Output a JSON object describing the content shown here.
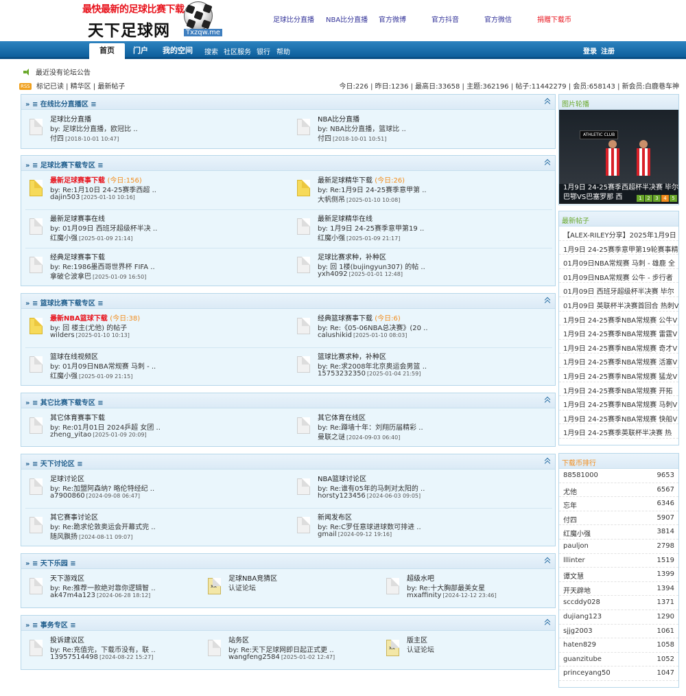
{
  "site": {
    "slogan": "最快最新的足球比赛下载",
    "name": "天下足球网",
    "url": "Txzqw.me"
  },
  "top_links": [
    "足球比分直播",
    "NBA比分直播",
    "官方微博",
    "官方抖音",
    "官方微信",
    "捐赠下载币"
  ],
  "nav": {
    "tabs": [
      "首页",
      "门户",
      "我的空间"
    ],
    "subs": [
      "搜索",
      "社区服务",
      "银行",
      "帮助"
    ],
    "login": "登录",
    "register": "注册"
  },
  "notice": "最近没有论坛公告",
  "quick_links": {
    "rss": "RSS",
    "text": "标记已读 | 精华区 | 最新帖子"
  },
  "stats": "今日:226 | 昨日:1236 | 最高日:33658 | 主题:362196 | 帖子:11442279 | 会员:658143 | 新会员:白鹿巷车神",
  "sections": [
    {
      "title": "» ≡ 在线比分直播区 ≡",
      "forums": [
        {
          "name": "足球比分直播",
          "by": "by: 足球比分直播，欧冠比 ..",
          "author": "付四",
          "date": "[2018-10-01 10:47]"
        },
        {
          "name": "NBA比分直播",
          "by": "by: NBA比分直播，篮球比 ..",
          "author": "付四",
          "date": "[2018-10-01 10:51]"
        }
      ]
    },
    {
      "title": "» ≡ 足球比赛下载专区 ≡",
      "forums": [
        {
          "name": "最新足球赛事下载",
          "today": "(今日:156)",
          "by": "by: Re:1月10日 24-25赛季西超 ..",
          "author": "dajin503",
          "date": "[2025-01-10 10:16]"
        },
        {
          "name": "最新足球精华下载",
          "today": "(今日:26)",
          "by": "by: Re:1月9日 24-25赛季意甲第 ..",
          "author": "大帆侧吊",
          "date": "[2025-01-10 10:08]"
        },
        {
          "name": "最新足球赛事在线",
          "by": "by: 01月09日 西班牙超级杯半决 ..",
          "author": "红魔小强",
          "date": "[2025-01-09 21:14]"
        },
        {
          "name": "最新足球精华在线",
          "by": "by: 1月9日 24-25赛季意甲第19 ..",
          "author": "红魔小强",
          "date": "[2025-01-09 21:17]"
        },
        {
          "name": "经典足球赛事下载",
          "by": "by: Re:1986墨西哥世界杯 FIFA ..",
          "author": "拿破仑波拿巴",
          "date": "[2025-01-09 16:50]"
        },
        {
          "name": "足球比赛求种，补种区",
          "by": "by: 回 1楼(bujingyun307) 的帖 ..",
          "author": "yxh4092",
          "date": "[2025-01-01 12:48]"
        }
      ]
    },
    {
      "title": "» ≡ 篮球比赛下载专区 ≡",
      "forums": [
        {
          "name": "最新NBA篮球下载",
          "today": "(今日:38)",
          "by": "by: 回 楼主(尤他) 的帖子",
          "author": "wilders",
          "date": "[2025-01-10 10:13]"
        },
        {
          "name": "经典篮球赛事下载",
          "today": "(今日:6)",
          "by": "by: Re:《05-06NBA总决赛》(20 ..",
          "author": "calushikid",
          "date": "[2025-01-10 08:03]"
        },
        {
          "name": "篮球在线视频区",
          "by": "by: 01月09日NBA常规赛 马刺 - ..",
          "author": "红魔小强",
          "date": "[2025-01-09 21:15]"
        },
        {
          "name": "篮球比赛求种，补种区",
          "by": "by: Re:求2008年北京奥运会男篮 ..",
          "author": "15753232350",
          "date": "[2025-01-04 21:59]"
        }
      ]
    },
    {
      "title": "» ≡ 其它比赛下载专区 ≡",
      "forums": [
        {
          "name": "其它体育赛事下载",
          "by": "by: Re:01月01日 2024乒超 女团 ..",
          "author": "zheng_yitao",
          "date": "[2025-01-09 20:09]"
        },
        {
          "name": "其它体育在线区",
          "by": "by: Re:蹲墙十年：刘翔历届精彩 ..",
          "author": "曼联之谜",
          "date": "[2024-09-03 06:40]"
        }
      ]
    },
    {
      "title": "» ≡ 天下讨论区 ≡",
      "forums": [
        {
          "name": "足球讨论区",
          "by": "by: Re:加盟阿森纳? 略伦特经纪 ..",
          "author": "a7900860",
          "date": "[2024-09-08 06:47]"
        },
        {
          "name": "NBA篮球讨论区",
          "by": "by: Re:谁有05年的马刺对太阳的 ..",
          "author": "horsty123456",
          "date": "[2024-06-03 09:05]"
        },
        {
          "name": "其它赛事讨论区",
          "by": "by: Re:跪求伦敦奥运会开幕式完 ..",
          "author": "随风飘扬",
          "date": "[2024-08-11 09:07]"
        },
        {
          "name": "新闻发布区",
          "by": "by: Re:C罗任意球进球数可排进 ..",
          "author": "gmail",
          "date": "[2024-09-12 19:16]"
        }
      ]
    },
    {
      "title": "» ≡ 天下乐园 ≡",
      "forums": [
        {
          "name": "天下游戏区",
          "by": "by: Re:推荐一款绝对靠你逻辑智 ..",
          "author": "ak47m4a123",
          "date": "[2024-06-28 18:12]"
        },
        {
          "name": "足球NBA竞猜区",
          "by": "认证论坛"
        },
        {
          "name": "超级水吧",
          "by": "by: Re:十大胸部最美女星",
          "author": "mxaffinity",
          "date": "[2024-12-12 23:46]"
        }
      ]
    },
    {
      "title": "» ≡ 事务专区 ≡",
      "forums": [
        {
          "name": "投诉建议区",
          "by": "by: Re:充值完，下载币没有，联 ..",
          "author": "13957514498",
          "date": "[2024-08-22 15:27]"
        },
        {
          "name": "站务区",
          "by": "by: Re:天下足球网即日起正式更 ..",
          "author": "wangfeng2584",
          "date": "[2025-01-02 12:47]"
        },
        {
          "name": "版主区",
          "by": "认证论坛"
        }
      ]
    }
  ],
  "sidebar": {
    "carousel": {
      "title": "图片轮播",
      "club": "ATHLETIC CLUB",
      "caption1": "1月9日 24-25赛季西超杯半决赛 毕尔",
      "caption2": "巴鄂VS巴塞罗那 西",
      "dots": [
        "1",
        "2",
        "3",
        "4",
        "5"
      ]
    },
    "latest": {
      "title": "最新帖子",
      "items": [
        "【ALEX-RILEY分享】2025年1月9日",
        "1月9日 24-25赛季意甲第19轮赛事精",
        "01月09日NBA常规赛 马刺 - 雄鹿 全",
        "01月09日NBA常规赛 公牛 - 步行者",
        "01月09日 西班牙超级杯半决赛 毕尔",
        "01月09日 英联杯半决赛首回合 热刺V",
        "1月9日 24-25赛季NBA常规赛 公牛V",
        "1月9日 24-25赛季NBA常规赛 雷霆V",
        "1月9日 24-25赛季NBA常规赛 奇才V",
        "1月9日 24-25赛季NBA常规赛 活塞V",
        "1月9日 24-25赛季NBA常规赛 猛龙V",
        "1月9日 24-25赛季NBA常规赛 开拓",
        "1月9日 24-25赛季NBA常规赛 马刺V",
        "1月9日 24-25赛季NBA常规赛 快船V",
        "1月9日 24-25赛季英联杯半决赛 热"
      ]
    },
    "ranking": {
      "title": "下载币排行",
      "items": [
        {
          "name": "88581000",
          "n": "9653"
        },
        {
          "name": "尤他",
          "n": "6567"
        },
        {
          "name": "忘年",
          "n": "6346"
        },
        {
          "name": "付四",
          "n": "5907"
        },
        {
          "name": "红魔小强",
          "n": "3814"
        },
        {
          "name": "pauljon",
          "n": "2798"
        },
        {
          "name": "lllinter",
          "n": "1519"
        },
        {
          "name": "谭文慧",
          "n": "1399"
        },
        {
          "name": "开天辟地",
          "n": "1394"
        },
        {
          "name": "sccddy028",
          "n": "1371"
        },
        {
          "name": "dujiang123",
          "n": "1290"
        },
        {
          "name": "sjjg2003",
          "n": "1061"
        },
        {
          "name": "haten829",
          "n": "1058"
        },
        {
          "name": "guanzitube",
          "n": "1052"
        },
        {
          "name": "princeyang50",
          "n": "1047"
        }
      ]
    }
  }
}
